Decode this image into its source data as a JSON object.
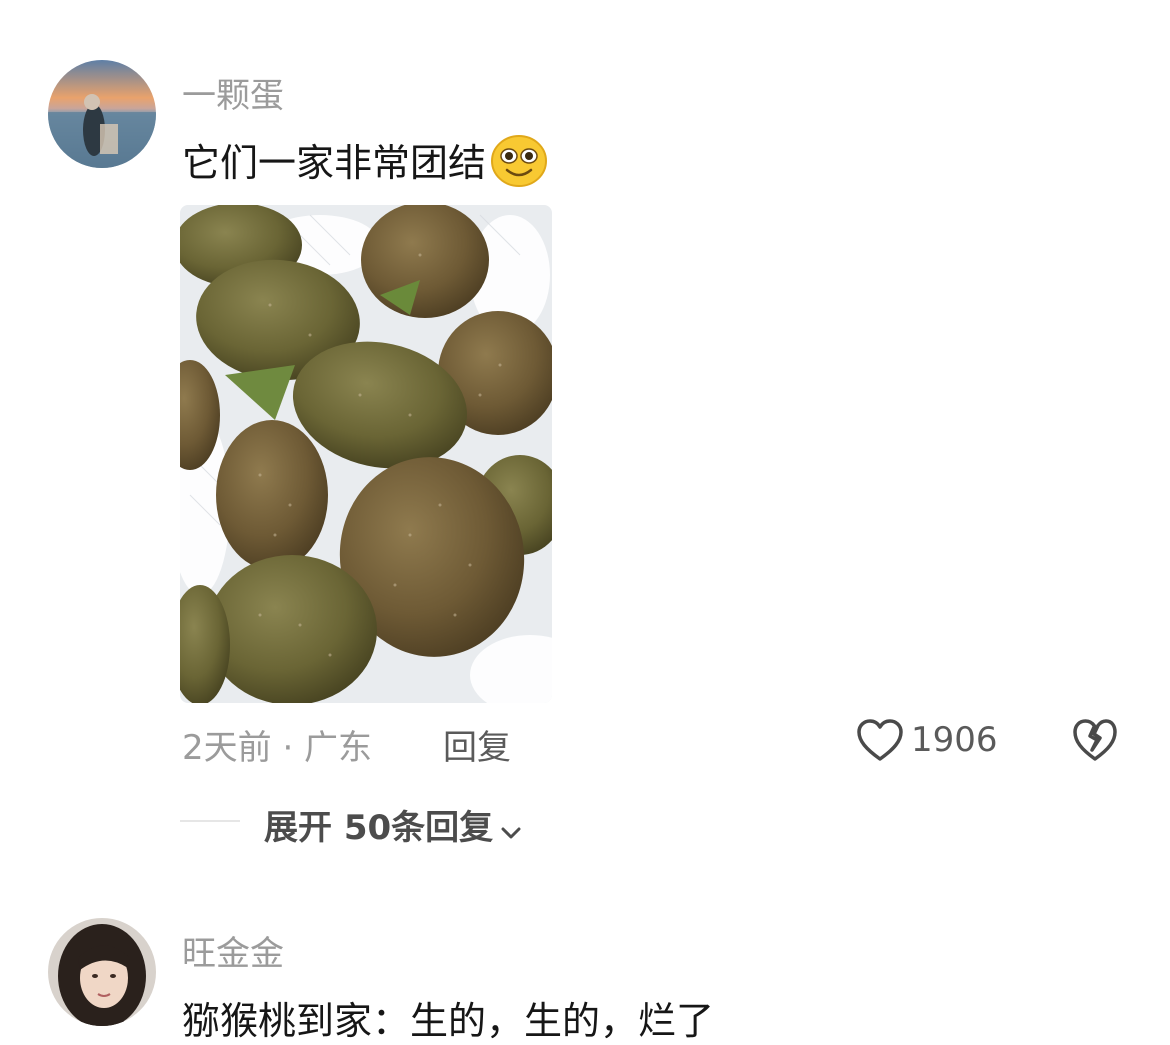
{
  "comments": [
    {
      "username": "一颗蛋",
      "text": "它们一家非常团结",
      "emoji": "smiley-emoji",
      "has_image": true,
      "meta": "2天前 · 广东",
      "reply_label": "回复",
      "like_count": "1906",
      "expand_label": "展开 50条回复"
    },
    {
      "username": "旺金金",
      "text": "猕猴桃到家：生的，生的，烂了"
    }
  ],
  "icons": {
    "like": "heart-outline-icon",
    "dislike": "broken-heart-icon",
    "expand": "chevron-down-icon"
  }
}
